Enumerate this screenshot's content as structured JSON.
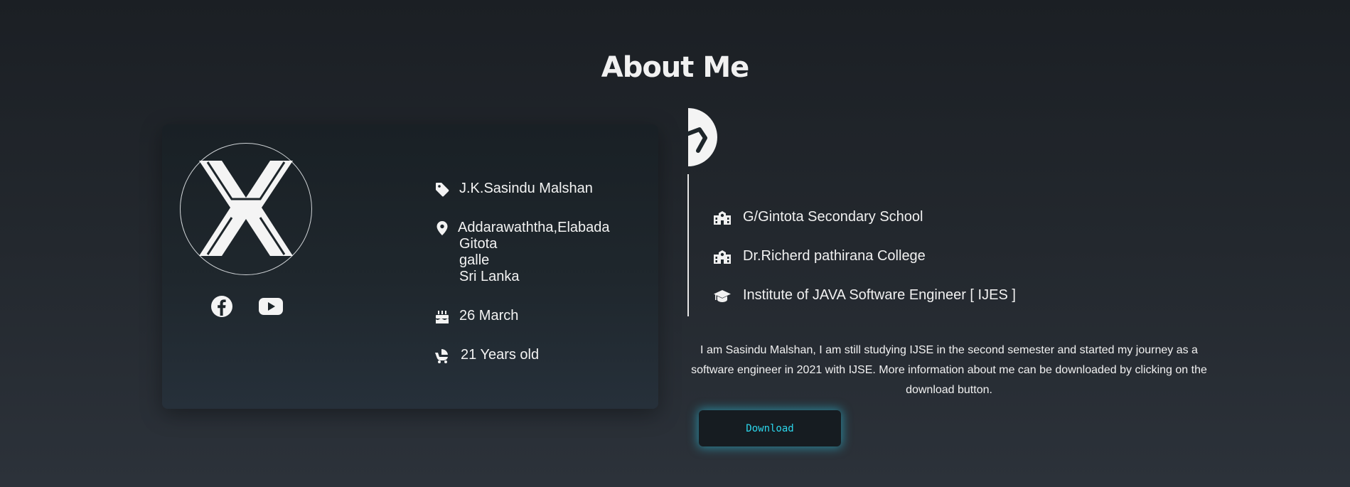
{
  "header": {
    "title": "About Me"
  },
  "profile": {
    "name": "J.K.Sasindu Malshan",
    "address_lines": [
      "Addarawaththa,Elabada",
      "Gitota",
      "galle",
      "Sri Lanka"
    ],
    "birthday": "26 March",
    "age": "21 Years old",
    "socials": [
      {
        "icon": "facebook-icon"
      },
      {
        "icon": "youtube-icon"
      }
    ]
  },
  "education": [
    {
      "icon": "school-icon",
      "label": "G/Gintota Secondary School"
    },
    {
      "icon": "school-icon",
      "label": "Dr.Richerd pathirana College"
    },
    {
      "icon": "graduation-cap-icon",
      "label": "Institute of JAVA Software Engineer [ IJES ]"
    }
  ],
  "bio": "I am Sasindu Malshan, I am still studying IJSE in the second semester and started my journey as a software engineer in 2021 with IJSE. More information about me can be downloaded by clicking on the download button.",
  "download_button": {
    "label": "Download"
  },
  "colors": {
    "accent": "#2cd7ec",
    "card_bg": "#1c2429",
    "text": "#f2f2f2"
  }
}
